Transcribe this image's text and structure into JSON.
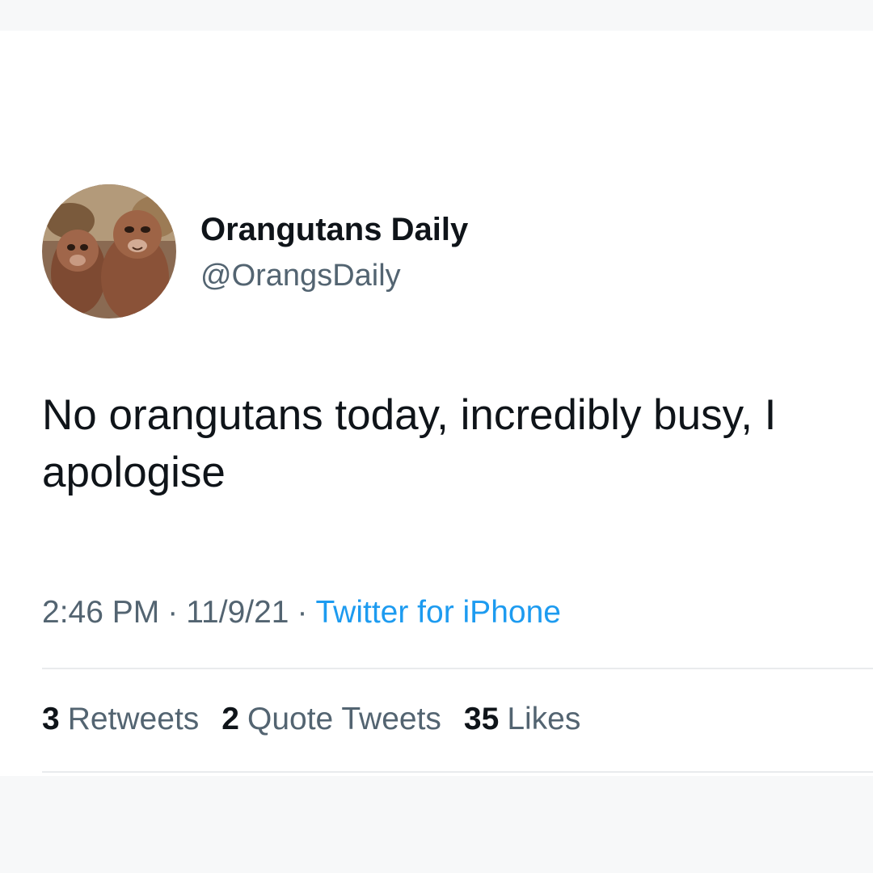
{
  "tweet": {
    "author": {
      "display_name": "Orangutans Daily",
      "handle": "@OrangsDaily",
      "avatar_icon": "orangutan-avatar"
    },
    "text": "No orangutans today, incredibly busy, I apologise",
    "time": "2:46 PM",
    "date": "11/9/21",
    "separator": "·",
    "source": "Twitter for iPhone",
    "stats": {
      "retweets_count": "3",
      "retweets_label": "Retweets",
      "quote_tweets_count": "2",
      "quote_tweets_label": "Quote Tweets",
      "likes_count": "35",
      "likes_label": "Likes"
    }
  },
  "colors": {
    "text_primary": "#0f1419",
    "text_secondary": "#536471",
    "link": "#1d9bf0",
    "divider": "#e9ebed",
    "background": "#ffffff"
  }
}
